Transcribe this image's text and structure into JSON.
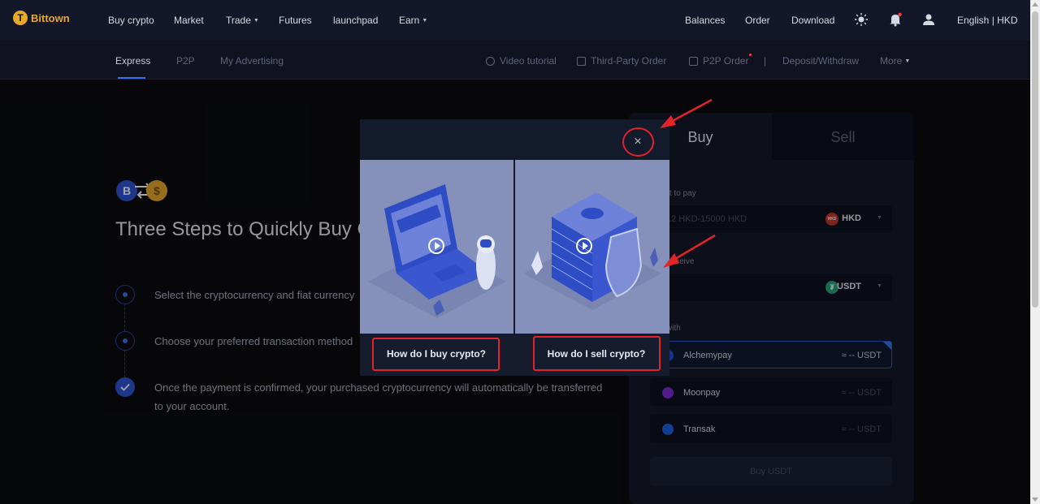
{
  "brand": {
    "name": "Bittown",
    "color": "#e7a92a"
  },
  "top_nav": {
    "items": [
      "Buy crypto",
      "Market",
      "Trade",
      "Futures",
      "launchpad",
      "Earn"
    ],
    "right": {
      "balances": "Balances",
      "order": "Order",
      "download": "Download",
      "language": "English | HKD"
    }
  },
  "sub_nav": {
    "tabs": [
      "Express",
      "P2P",
      "My Advertising"
    ],
    "right": {
      "video_tutorial": "Video tutorial",
      "third_party_order": "Third-Party Order",
      "p2p_order": "P2P Order",
      "deposit_withdraw": "Deposit/Withdraw",
      "more": "More"
    }
  },
  "hero": {
    "title": "Three Steps to Quickly Buy Crypto",
    "steps": [
      "Select the cryptocurrency and fiat currency",
      "Choose your preferred transaction method",
      "Once the payment is confirmed, your purchased cryptocurrency will automatically be transferred"
    ],
    "step3_line2": "to your account."
  },
  "trade_panel": {
    "tabs": {
      "buy": "Buy",
      "sell": "Sell"
    },
    "pay_label": "I want to pay",
    "pay_placeholder": "12 HKD-15000 HKD",
    "pay_currency": "HKD",
    "receive_label": "I will receive",
    "receive_currency": "USDT",
    "pay_with_label": "Pay with",
    "providers": [
      {
        "name": "Alchemypay",
        "rate": "≈ -- USDT",
        "selected": true
      },
      {
        "name": "Moonpay",
        "rate": "≈ -- USDT",
        "selected": false
      },
      {
        "name": "Transak",
        "rate": "≈ -- USDT",
        "selected": false
      }
    ],
    "buy_button": "Buy USDT"
  },
  "modal": {
    "close": "×",
    "buy_video_button": "How do I buy crypto?",
    "sell_video_button": "How do I sell crypto?"
  },
  "colors": {
    "accent": "#3b6df0",
    "annotation": "#e0242a",
    "background": "#0b0c10"
  }
}
